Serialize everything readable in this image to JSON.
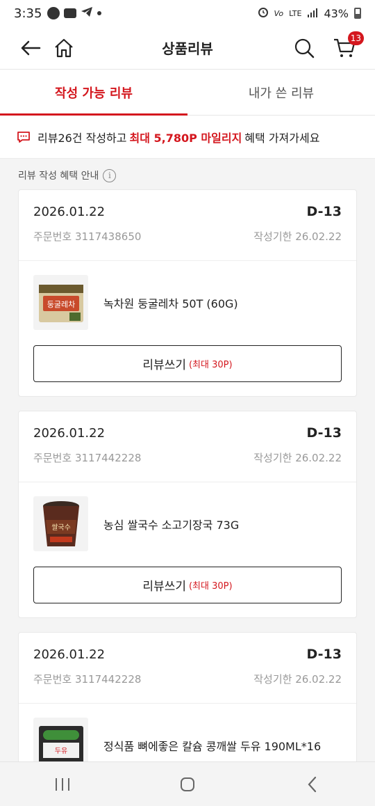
{
  "status_bar": {
    "time": "3:35",
    "battery": "43%",
    "network": "LTE"
  },
  "app_bar": {
    "title": "상품리뷰",
    "cart_count": "13"
  },
  "tabs": [
    {
      "label": "작성 가능 리뷰",
      "active": true
    },
    {
      "label": "내가 쓴 리뷰",
      "active": false
    }
  ],
  "notice": {
    "prefix": "리뷰26건 작성하고",
    "highlight": "최대 5,780P 마일리지",
    "suffix": "혜택 가져가세요"
  },
  "guide": {
    "label": "리뷰 작성 혜택 안내",
    "icon": "i"
  },
  "orders": [
    {
      "date": "2026.01.22",
      "dday": "D-13",
      "order_no": "주문번호 3117438650",
      "deadline": "작성기한 26.02.22",
      "product": "녹차원 둥굴레차 50T (60G)",
      "thumb_text": "둥굴레차",
      "button": "리뷰쓰기",
      "points": "(최대 30P)"
    },
    {
      "date": "2026.01.22",
      "dday": "D-13",
      "order_no": "주문번호 3117442228",
      "deadline": "작성기한 26.02.22",
      "product": "농심 쌀국수 소고기장국 73G",
      "thumb_text": "쌀국수",
      "button": "리뷰쓰기",
      "points": "(최대 30P)"
    },
    {
      "date": "2026.01.22",
      "dday": "D-13",
      "order_no": "주문번호 3117442228",
      "deadline": "작성기한 26.02.22",
      "product": "정식품 뼈에좋은 칼슘 콩깨쌀 두유 190ML*16",
      "thumb_text": "두유"
    }
  ],
  "colors": {
    "accent": "#d4171e",
    "background": "#f4f4f4"
  }
}
